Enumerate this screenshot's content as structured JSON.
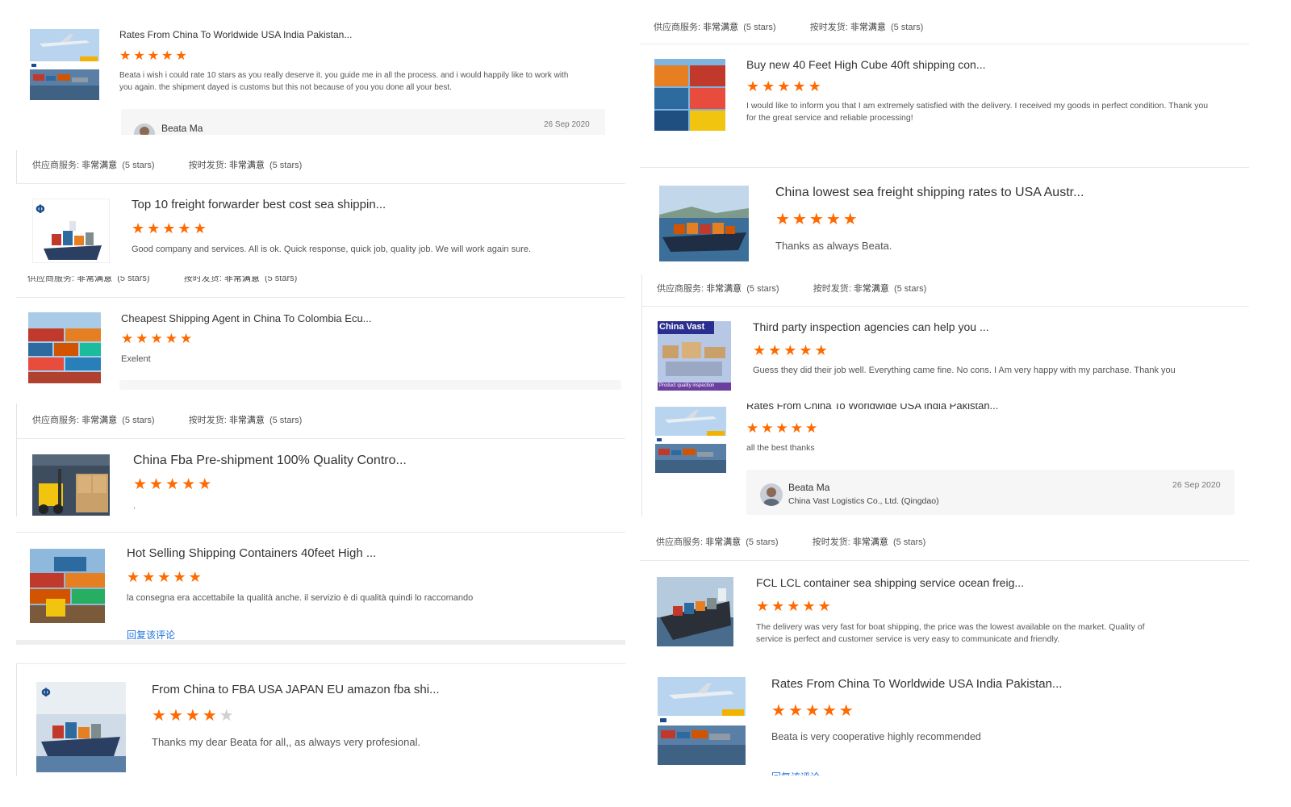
{
  "meta": {
    "service_label": "供应商服务:",
    "service_value": "非常满意",
    "shipping_label": "按时发货:",
    "shipping_value": "非常满意",
    "stars_text": "(5 stars)"
  },
  "reply_link": "回复该评论",
  "colors": {
    "star": "#ff6a00",
    "star_off": "#cfcfcf",
    "link": "#1f73d9"
  },
  "reviews": [
    {
      "title": "Rates From China To Worldwide USA India Pakistan...",
      "rating": 5,
      "text": "Beata i wish i could rate 10 stars as you really deserve it. you guide me in all the process. and i would happily like to work with you again. the shipment dayed is customs but this not because of you you done all your best.",
      "reviewer": "Beata Ma",
      "date": "26 Sep 2020",
      "image": "airplane-port"
    },
    {
      "title": "Top 10 freight forwarder best cost sea shippin...",
      "rating": 5,
      "text": "Good company and services. All is ok. Quick response, quick job, quality job. We will work again sure.",
      "image": "ship-logo"
    },
    {
      "title": "Cheapest Shipping Agent in China To Colombia Ecu...",
      "rating": 5,
      "text": "Exelent",
      "image": "containers"
    },
    {
      "title": "China Fba Pre-shipment 100% Quality Contro...",
      "rating": 5,
      "text": ".",
      "image": "warehouse"
    },
    {
      "title": "Hot Selling Shipping Containers 40feet High ...",
      "rating": 5,
      "text": "la consegna era accettabile la qualità anche. il servizio è di qualità quindi lo raccomando",
      "image": "container-yard"
    },
    {
      "title": "From China to FBA USA JAPAN EU amazon fba shi...",
      "rating": 4,
      "text": "Thanks  my dear Beata for all,, as always very profesional.",
      "image": "ship-brochure"
    },
    {
      "title": "Buy new 40 Feet High Cube 40ft shipping con...",
      "rating": 5,
      "text": "I would like to inform you that I am extremely satisfied with the delivery. I received my goods in perfect condition. Thank you for the great service and reliable processing!",
      "image": "container-stack"
    },
    {
      "title": "China lowest sea freight shipping rates to USA Austr...",
      "rating": 5,
      "text": "Thanks as always Beata.",
      "image": "cargo-ship-sea"
    },
    {
      "title": "Third party inspection agencies can help you ...",
      "rating": 5,
      "text": "Guess they did their job well. Everything came fine. No cons. I Am very happy with my parchase. Thank you",
      "image": "inspection-banner",
      "image_brand": "China Vast",
      "image_caption": "Product quality inspection"
    },
    {
      "title": "Rates From China To Worldwide USA India Pakistan...",
      "rating": 5,
      "text": "all the best thanks",
      "reviewer": "Beata Ma",
      "company": "China Vast Logistics Co., Ltd. (Qingdao)",
      "date": "26 Sep 2020",
      "image": "airplane-port"
    },
    {
      "title": "FCL LCL container sea shipping service ocean freig...",
      "rating": 5,
      "text": "The delivery was very fast for boat shipping, the price was the lowest available on the market. Quality of service is perfect and customer service is very easy to communicate and friendly.",
      "image": "container-ship"
    },
    {
      "title": "Rates From China To Worldwide USA India Pakistan...",
      "rating": 5,
      "text": "Beata is very cooperative highly recommended",
      "image": "airplane-port"
    }
  ]
}
